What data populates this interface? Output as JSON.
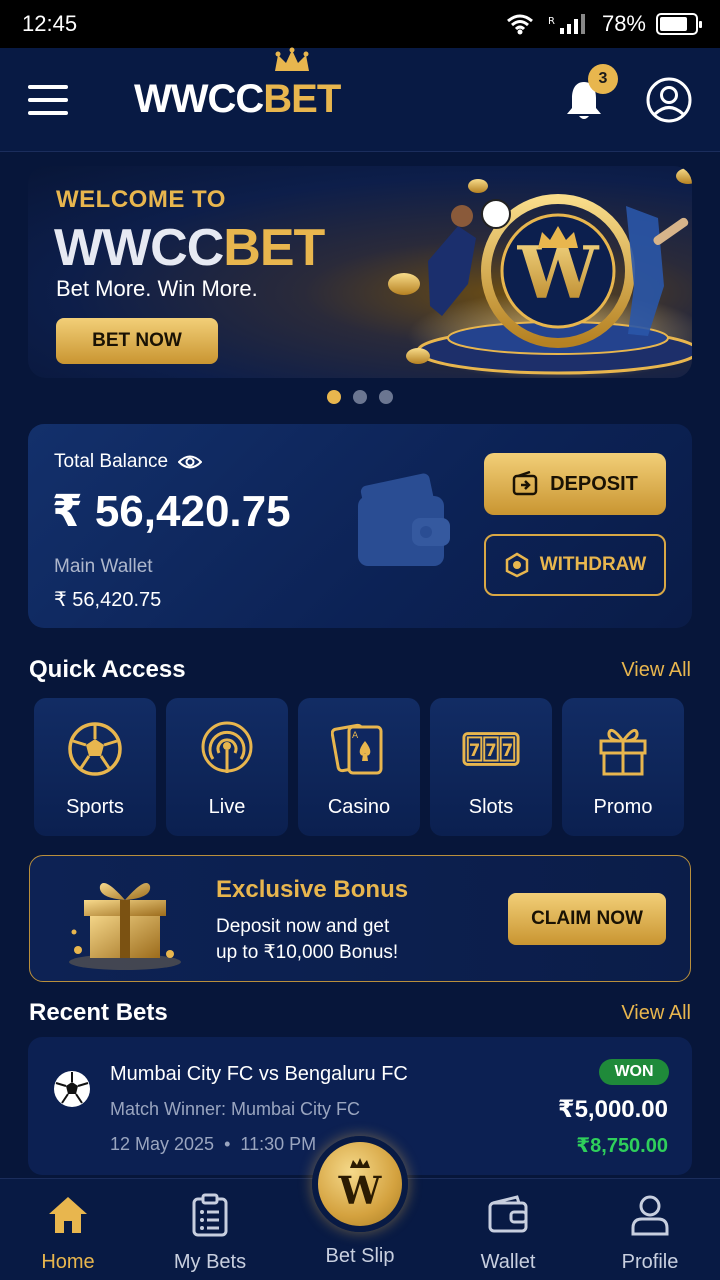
{
  "status_bar": {
    "time": "12:45",
    "battery": "78%"
  },
  "header": {
    "logo_part1": "WWCC",
    "logo_part2": "BET",
    "notification_count": "3"
  },
  "banner": {
    "welcome": "WELCOME TO",
    "brand_part1": "WWCC",
    "brand_part2": "BET",
    "tagline": "Bet More. Win More.",
    "cta": "BET NOW",
    "slides": 3,
    "active_slide": 1
  },
  "balance": {
    "label": "Total Balance",
    "amount": "₹ 56,420.75",
    "main_wallet_label": "Main Wallet",
    "main_wallet_value": "₹ 56,420.75",
    "deposit_label": "DEPOSIT",
    "withdraw_label": "WITHDRAW"
  },
  "quick_access": {
    "title": "Quick Access",
    "view_all": "View All",
    "items": [
      {
        "label": "Sports",
        "icon": "soccer-ball-icon"
      },
      {
        "label": "Live",
        "icon": "broadcast-icon"
      },
      {
        "label": "Casino",
        "icon": "playing-cards-icon"
      },
      {
        "label": "Slots",
        "icon": "slot-777-icon"
      },
      {
        "label": "Promo",
        "icon": "gift-icon"
      }
    ]
  },
  "bonus": {
    "title": "Exclusive Bonus",
    "line1": "Deposit now and get",
    "line2": "up to ₹10,000 Bonus!",
    "cta": "CLAIM NOW"
  },
  "recent_bets": {
    "title": "Recent Bets",
    "view_all": "View All",
    "items": [
      {
        "match": "Mumbai City FC vs Bengaluru FC",
        "market": "Match Winner: Mumbai City FC",
        "date": "12 May 2025",
        "time": "11:30 PM",
        "status": "WON",
        "stake": "₹5,000.00",
        "payout": "₹8,750.00"
      }
    ]
  },
  "bottom_nav": {
    "items": [
      {
        "label": "Home",
        "icon": "home-icon",
        "active": true
      },
      {
        "label": "My Bets",
        "icon": "clipboard-icon",
        "active": false
      },
      {
        "label": "Bet Slip",
        "icon": "betslip-logo-icon",
        "active": false
      },
      {
        "label": "Wallet",
        "icon": "wallet-icon",
        "active": false
      },
      {
        "label": "Profile",
        "icon": "user-icon",
        "active": false
      }
    ]
  },
  "colors": {
    "background": "#07163a",
    "gold": "#e8b64e",
    "won_green": "#1f8a3a",
    "payout_green": "#2fcf5b"
  }
}
